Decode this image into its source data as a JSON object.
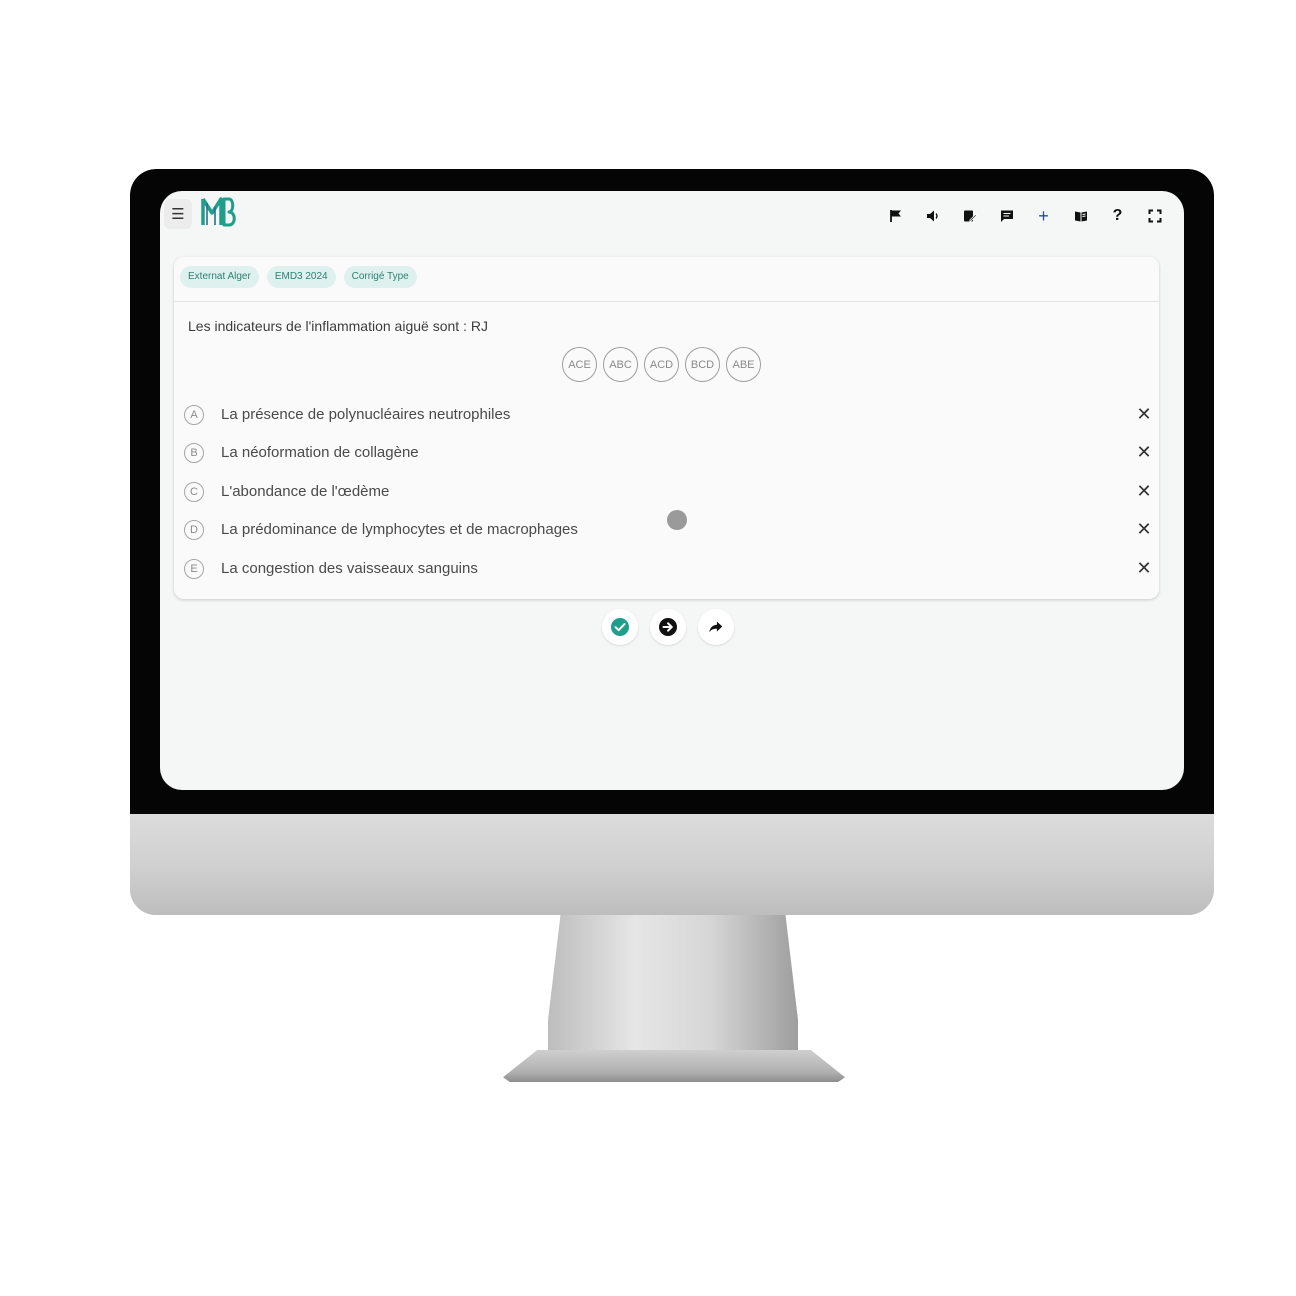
{
  "app": {
    "logo_text": "MB",
    "menu_icon": "menu-icon",
    "brand_color": "#1f9e8c",
    "screen_background": "#f5f6f6"
  },
  "toolbar": {
    "icons": [
      "flag-icon",
      "volume-icon",
      "edit-note-icon",
      "comment-icon",
      "add-icon",
      "book-icon",
      "help-icon",
      "fullscreen-icon"
    ],
    "add_label": "+",
    "help_label": "?"
  },
  "tags": [
    "Externat Alger",
    "EMD3 2024",
    "Corrigé Type"
  ],
  "question": {
    "text": "Les indicateurs de l'inflammation aiguë sont : RJ"
  },
  "answer_suggestions": [
    "ACE",
    "ABC",
    "ACD",
    "BCD",
    "ABE"
  ],
  "options": [
    {
      "letter": "A",
      "text": "La présence de polynucléaires neutrophiles",
      "remove_label": "✕"
    },
    {
      "letter": "B",
      "text": "La néoformation de collagène",
      "remove_label": "✕"
    },
    {
      "letter": "C",
      "text": "L'abondance de l'œdème",
      "remove_label": "✕"
    },
    {
      "letter": "D",
      "text": "La prédominance de lymphocytes et de macrophages",
      "remove_label": "✕"
    },
    {
      "letter": "E",
      "text": "La congestion des vaisseaux sanguins",
      "remove_label": "✕"
    }
  ],
  "actions": [
    "check-circle-icon",
    "arrow-right-circle-icon",
    "share-icon"
  ],
  "colors": {
    "tag_bg": "#dff1ef",
    "tag_text": "#2f7f73",
    "check_green": "#1f9e8c"
  }
}
